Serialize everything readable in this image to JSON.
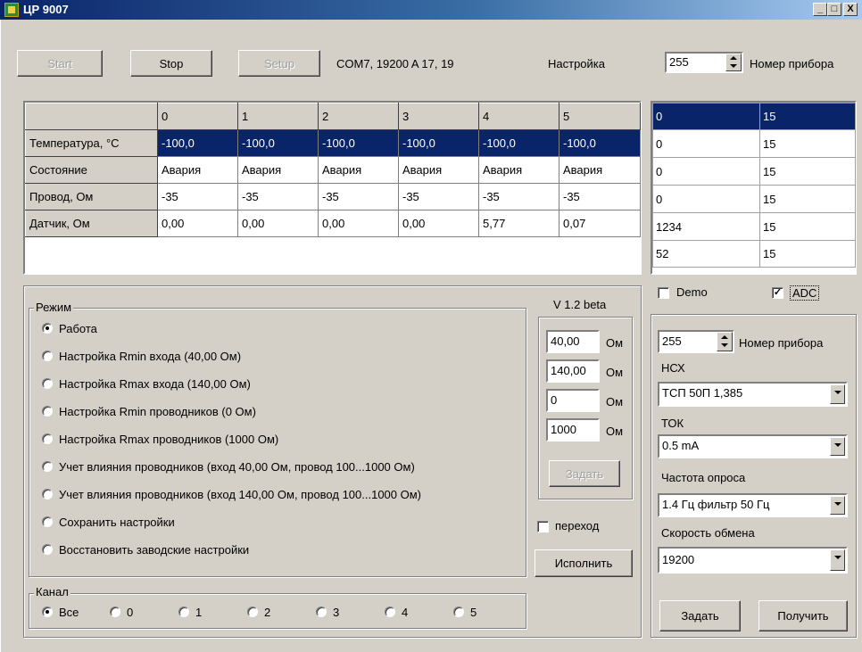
{
  "window": {
    "title": "ЦР 9007",
    "minimize": "_",
    "maximize": "□",
    "close": "X"
  },
  "toolbar": {
    "start_label": "Start",
    "stop_label": "Stop",
    "setup_label": "Setup",
    "port_info": "COM7, 19200 A 17, 19",
    "settings_label": "Настройка",
    "device_number_value": "255",
    "device_number_label": "Номер прибора"
  },
  "main_table": {
    "columns": [
      "0",
      "1",
      "2",
      "3",
      "4",
      "5"
    ],
    "rows": [
      {
        "label": "Температура, °C",
        "values": [
          "-100,0",
          "-100,0",
          "-100,0",
          "-100,0",
          "-100,0",
          "-100,0"
        ]
      },
      {
        "label": "Состояние",
        "values": [
          "Авария",
          "Авария",
          "Авария",
          "Авария",
          "Авария",
          "Авария"
        ]
      },
      {
        "label": "Провод, Ом",
        "values": [
          "-35",
          "-35",
          "-35",
          "-35",
          "-35",
          "-35"
        ]
      },
      {
        "label": "Датчик, Ом",
        "values": [
          "0,00",
          "0,00",
          "0,00",
          "0,00",
          "5,77",
          "0,07"
        ]
      }
    ]
  },
  "right_table": {
    "rows": [
      [
        "0",
        "15"
      ],
      [
        "0",
        "15"
      ],
      [
        "0",
        "15"
      ],
      [
        "0",
        "15"
      ],
      [
        "1234",
        "15"
      ],
      [
        "52",
        "15"
      ]
    ]
  },
  "mode": {
    "title": "Режим",
    "options": [
      "Работа",
      "Настройка Rmin входа (40,00 Ом)",
      "Настройка Rmax входа (140,00 Ом)",
      "Настройка Rmin проводников (0 Ом)",
      "Настройка Rmax проводников (1000 Ом)",
      "Учет влияния проводников (вход 40,00 Ом, провод 100...1000 Ом)",
      "Учет влияния проводников (вход 140,00 Ом, провод 100...1000 Ом)",
      "Сохранить настройки",
      "Восстановить заводские настройки"
    ],
    "selected_index": 0
  },
  "calib": {
    "version": "V 1.2 beta",
    "fields": [
      {
        "value": "40,00",
        "unit": "Ом"
      },
      {
        "value": "140,00",
        "unit": "Ом"
      },
      {
        "value": "0",
        "unit": "Ом"
      },
      {
        "value": "1000",
        "unit": "Ом"
      }
    ],
    "set_label": "Задать",
    "transition_label": "переход",
    "transition_checked": false,
    "execute_label": "Исполнить"
  },
  "channel": {
    "title": "Канал",
    "options": [
      "Все",
      "0",
      "1",
      "2",
      "3",
      "4",
      "5"
    ],
    "selected_index": 0
  },
  "flags": {
    "demo_label": "Demo",
    "demo_checked": false,
    "adc_label": "ADC",
    "adc_checked": true
  },
  "device_panel": {
    "device_number_value": "255",
    "device_number_label": "Номер прибора",
    "nsx_label": "НСХ",
    "nsx_value": "ТСП 50П   1,385",
    "current_label": "ТОК",
    "current_value": "0.5 mA",
    "freq_label": "Частота опроса",
    "freq_value": "1.4 Гц фильтр 50 Гц",
    "baud_label": "Скорость обмена",
    "baud_value": "19200",
    "set_label": "Задать",
    "get_label": "Получить"
  }
}
